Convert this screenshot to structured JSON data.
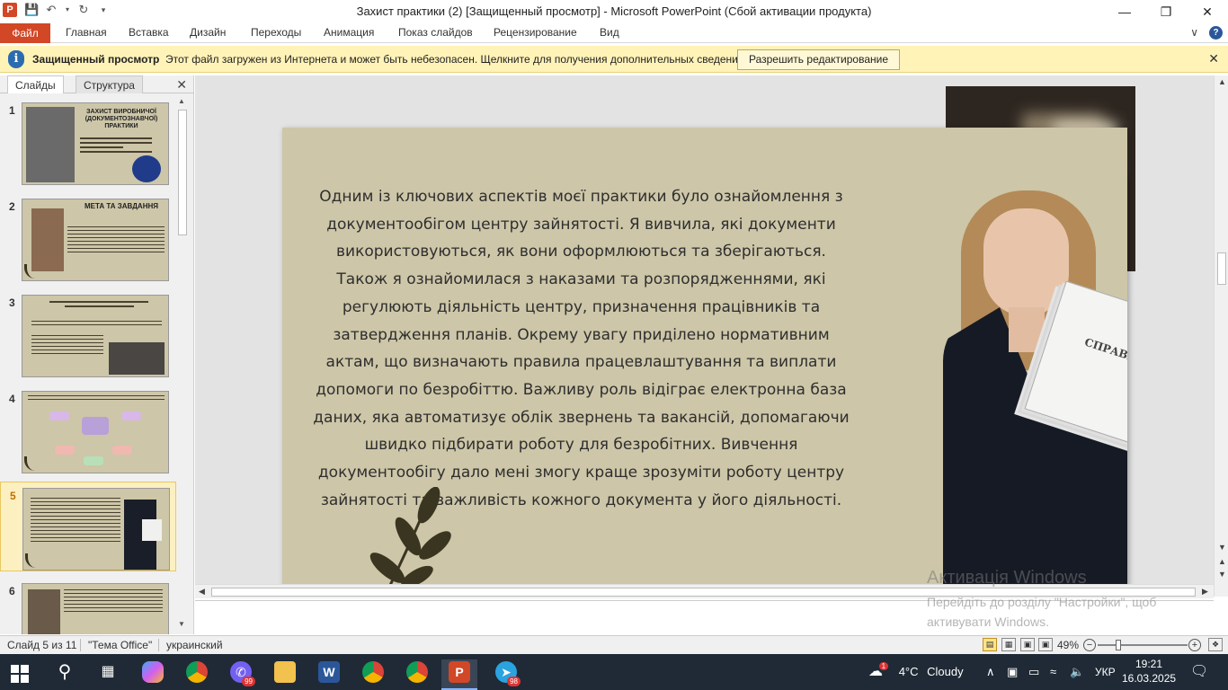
{
  "window": {
    "title": "Захист практики (2) [Защищенный просмотр]  -  Microsoft PowerPoint (Сбой активации продукта)",
    "app_icon": "P"
  },
  "ribbon": {
    "tabs": [
      "Файл",
      "Главная",
      "Вставка",
      "Дизайн",
      "Переходы",
      "Анимация",
      "Показ слайдов",
      "Рецензирование",
      "Вид"
    ]
  },
  "message_bar": {
    "title": "Защищенный просмотр",
    "message": "Этот файл загружен из Интернета и может быть небезопасен. Щелкните для получения дополнительных сведений.",
    "button": "Разрешить редактирование"
  },
  "left_pane": {
    "tabs": [
      "Слайды",
      "Структура"
    ],
    "slides": [
      {
        "number": "1",
        "title": "ЗАХИСТ ВИРОБНИЧОЇ (ДОКУМЕНТОЗНАВЧОЇ) ПРАКТИКИ"
      },
      {
        "number": "2",
        "title": "МЕТА ТА ЗАВДАННЯ"
      },
      {
        "number": "3",
        "title": ""
      },
      {
        "number": "4",
        "title": ""
      },
      {
        "number": "5",
        "title": ""
      },
      {
        "number": "6",
        "title": ""
      }
    ],
    "selected_slide": 5
  },
  "slide": {
    "body_text": "Одним із ключових аспектів моєї практики було ознайомлення з документообігом центру зайнятості. Я вивчила, які документи використовуються, як вони оформлюються та зберігаються. Також я ознайомилася з наказами та розпорядженнями, які регулюють діяльність центру, призначення працівників та затвердження планів. Окрему увагу приділено нормативним актам, що визначають правила працевлаштування та виплати допомоги по безробіттю. Важливу роль відіграє електронна база даних, яка автоматизує облік звернень та вакансій, допомагаючи швидко підбирати роботу для безробітних. Вивчення документообігу дало мені змогу краще зрозуміти роботу центру зайнятості та важливість кожного документа у його діяльності.",
    "papers_label": "СПРАВА №"
  },
  "watermark": {
    "line1": "Активація Windows",
    "line2": "Перейдіть до розділу \"Настройки\", щоб",
    "line3": "активувати Windows."
  },
  "status_bar": {
    "slide_info": "Слайд 5 из 11",
    "theme": "\"Тема Office\"",
    "language": "украинский",
    "zoom": "49%"
  },
  "taskbar": {
    "weather_temp": "4°C",
    "weather_text": "Cloudy",
    "weather_badge": "1",
    "language": "УКР",
    "time": "19:21",
    "date": "16.03.2025",
    "viber_badge": "99",
    "telegram_badge": "98"
  }
}
